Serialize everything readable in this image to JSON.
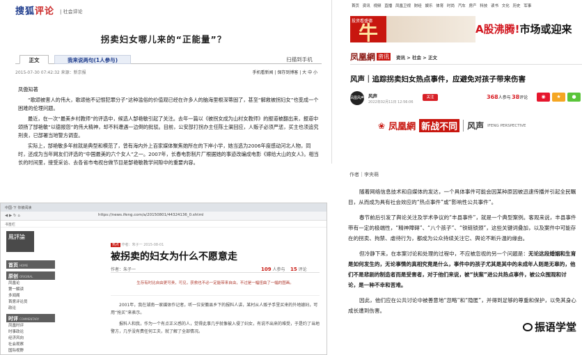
{
  "sohu": {
    "logo": "搜狐评论",
    "logo_left": "搜狐",
    "logo_right": "评论",
    "crumb": "| 社会评论",
    "title": "拐卖妇女哪儿来的“正能量”？",
    "tab_main": "正文",
    "tab_comment": "我来说两句(1人参与)",
    "tab_scan": "扫描到手机",
    "date": "2015-07-30 07:42:32    来源：新京报",
    "tools": "手机看新闻 | 保存到博客 | 大 中 小",
    "author": "凤傲知著",
    "p1": "“歌颂被害人的伟大，歌颂他不记恨犯罪分子”这种滥俗的价值观已经在许多人的脑海里根深蒂固了，甚至“解救被拐妇女”也变成一个困难的伦理问题。",
    "p2": "最近，在一次“最美乡村教师”的评选中，候选人郜艳敏引起了关注。去年一篇以《被拐女成为山村女教师》的报道被翻出来，报道中颂扬了郜艳敏“以德报怨”的伟大精神，却不料遭遇一边倒的批驳。目前，公安部打拐办主任陈士渠回应，人贩子必须严惩，买主也须追究刑责，已部署当地警方调查。",
    "p3": "实际上，郜艳敏多年前就是典型和模范了，曾有海内外上百家媒体聚焦她所在的下岸小学，她当选为2006年度感动河北人物，同时，还成为当年网友们评选的“中国最美的六个女人”之一。2007年，长春电影制片厂根据她的事迹改编成电影《嫁给大山的女人》。相当长的时间里，接受采访、去各省市电视台做节目是郜艳敏教学间隙中的重要内容。"
  },
  "ifeng_top": {
    "nav": "首页 资讯 视频 直播 凤凰卫视 财经 娱乐 体育 时尚 汽车 房产 科技 读书 文化 历史 军事",
    "banner_left": "投资看盛德",
    "banner_big": "牛",
    "banner_text_red": "A股沸腾!",
    "banner_text": "市场或迎来",
    "brand": "凤凰網",
    "brand_tag": "资讯",
    "crumb": "资讯 > 社会 > 正文",
    "title": "风声｜追踪拐卖妇女热点事件，应避免对孩子带来伤害",
    "author_avatar": "凤凰风声",
    "author_name": "风声",
    "author_time": "2022年02月11日 12:56:06",
    "follow": "关注",
    "count1": "368",
    "count1_label": "人参与",
    "count2": "38",
    "count2_label": "评论",
    "promo_logo": "凤凰網",
    "promo_tag": "新战不同",
    "promo_name": "风声",
    "promo_en": "IFENG PERSPECTIVE"
  },
  "ifeng_bottom": {
    "tabbar": "中国-下  你被阅读",
    "url": "https://news.ifeng.com/a/20150801/44324136_0.shtml",
    "bookmark": "书签栏",
    "logo": "鳳評論",
    "sec1": "首页",
    "sec1_en": "HOME",
    "sec2": "原创",
    "sec2_en": "ORIGINAL",
    "items2": [
      "凤凰论",
      "第一解读",
      "多闻阁",
      "首席评论员",
      "政论"
    ],
    "sec3": "时评",
    "sec3_en": "COMMENTARY",
    "items3": [
      "凤凰时评",
      "时事政论",
      "经济风向",
      "社会观察",
      "国际视野"
    ],
    "tag": "作者：朱子一   2015-08-01",
    "tag_red": "热点",
    "title": "被拐卖的妇女为什么不愿意走",
    "byline": "作者：朱子一",
    "c1": "109",
    "c1_label": "人参与",
    "c2": "15",
    "c2_label": "评论",
    "lead": "生存有时比自由更可贵，可见，获救也不必一定能带来自由，不过是一幅扭曲了一幅的图画。",
    "para1": "2001年，我在湖南一家媒体作记者，听一位安徽县乡下的报料人讲，某村从人贩子手里买来的外地媳妇，可用“抢买”来表示。",
    "para2": "报料人和我，作为一个有点正义感的人，觉得此事几乎就像被入侵了妇女，有说不出来的难受，于是约了当地警方，几乎没有费任何工夫，就了解了全部情况。"
  },
  "ifeng_text": {
    "author": "作者｜李夹萌",
    "p1": "随着网络信息技术和自媒体的发达，一个具体事件可能会因某种原因被迅速传播并引起全民瞩目，从而成为具有社会效应的“热点事件”或“影响性公共事件”。",
    "p2": "春节前后引发了舆论关注及学术争议的“丰县事件”，就是一个典型案例。客观来说，丰县事件带有一定的极端性，“精神障碍”、“八个孩子”、“铁链锁颈”，这些关键词叠加，以及案件中可能存在的拐卖、拘禁、虐待行为，都成为公众持续关注它、舆论不断升温的缘由。",
    "p3_a": "但冷静下来，在本案讨论和处理的过程中，不应被忽视的另一个问题是：",
    "p3_b": "无论这段婚姻和生育是如何发生的，无论事情的真相究竟是什么，事件中的孩子尤其是其中的未成年人则是无辜的，他们不是悲剧的制造者而是受害者，对于他们来说，被“扶案”进公共热点事件，被公众围观和讨论，是一种不幸和苦难。",
    "p4": "因此，他们应在公共讨论中被善意地“忽略”和“隐匿”，并得到足够的尊重和保护，以免其身心成长遭到伤害。",
    "watermark": "振语学堂"
  }
}
